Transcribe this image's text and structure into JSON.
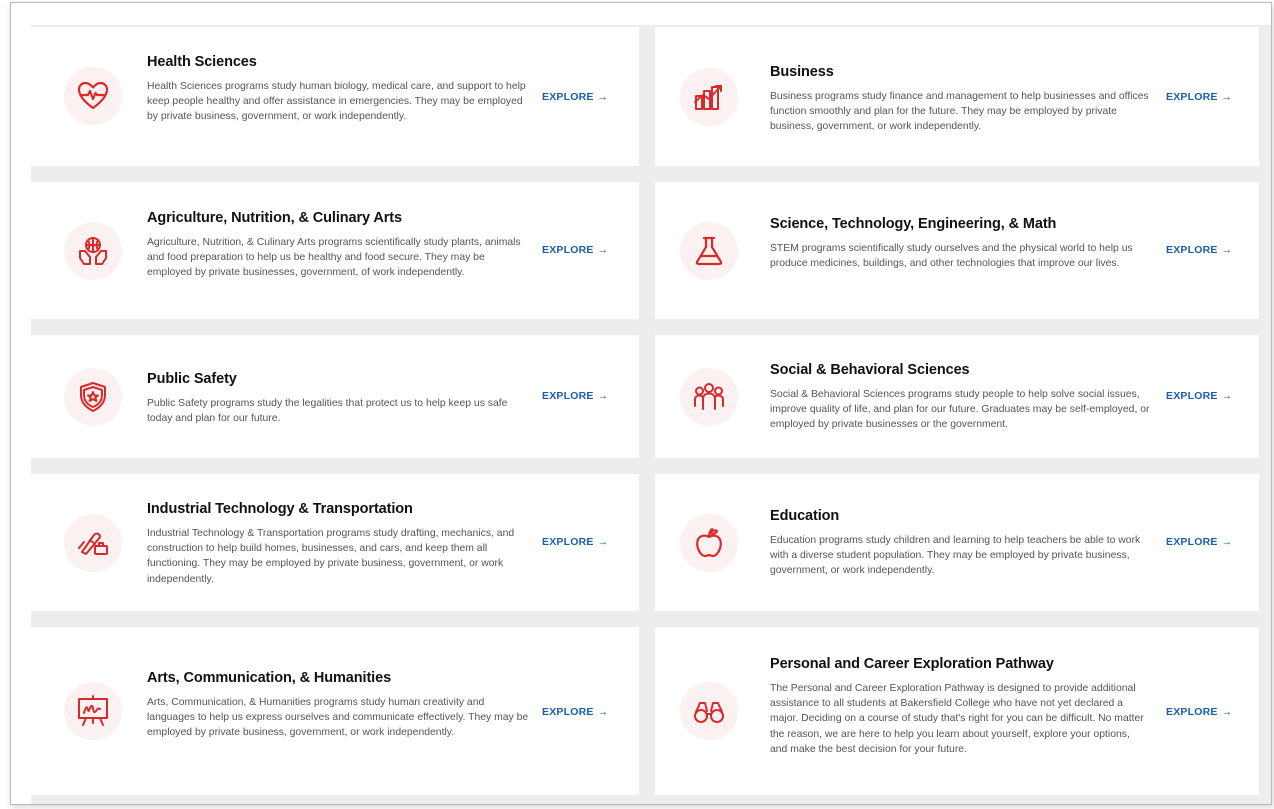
{
  "explore_label": "EXPLORE",
  "arrow": "→",
  "accent_color": "#d82a2a",
  "link_color": "#1c5fa8",
  "cards": [
    {
      "icon": "heart-pulse-icon",
      "title": "Health Sciences",
      "description": "Health Sciences programs study human biology, medical care, and support to help keep people healthy and offer assistance in emergencies. They may be employed by private business, government, or work independently."
    },
    {
      "icon": "business-chart-icon",
      "title": "Business",
      "description": "Business programs study finance and management to help businesses and offices function smoothly and plan for the future. They may be employed by private business, government, or work independently."
    },
    {
      "icon": "globe-hands-icon",
      "title": "Agriculture, Nutrition, & Culinary Arts",
      "description": "Agriculture, Nutrition, & Culinary Arts programs scientifically study plants, animals and food preparation to help us be healthy and food secure. They may be employed by private businesses, government, of work independently."
    },
    {
      "icon": "flask-icon",
      "title": "Science, Technology, Engineering, & Math",
      "description": "STEM programs scientifically study ourselves and the physical world to help us produce medicines, buildings, and other technologies that improve our lives."
    },
    {
      "icon": "shield-star-icon",
      "title": "Public Safety",
      "description": "Public Safety programs study the legalities that protect us to help keep us safe today and plan for our future."
    },
    {
      "icon": "people-group-icon",
      "title": "Social & Behavioral Sciences",
      "description": "Social & Behavioral Sciences programs study people to help solve social issues, improve quality of life, and plan for our future. Graduates may be self-employed, or employed by private businesses or the government."
    },
    {
      "icon": "tools-icon",
      "title": "Industrial Technology & Transportation",
      "description": "Industrial Technology & Transportation programs study drafting, mechanics, and construction to help build homes, businesses, and cars, and keep them all functioning. They may be employed by private business, government, or work independently."
    },
    {
      "icon": "apple-icon",
      "title": "Education",
      "description": "Education programs study children and learning to help teachers be able to work with a diverse student population. They may be employed by private business, government, or work independently."
    },
    {
      "icon": "easel-icon",
      "title": "Arts, Communication, & Humanities",
      "description": "Arts, Communication, & Humanities programs study human creativity and languages to help us express ourselves and communicate effectively. They may be employed by private business, government, or work independently."
    },
    {
      "icon": "binoculars-icon",
      "title": "Personal and Career Exploration Pathway",
      "description": "The Personal and Career Exploration Pathway is designed to provide additional assistance to all students at Bakersfield College who have not yet declared a major. Deciding on a course of study that's right for you can be difficult. No matter the reason, we are here to help you learn about yourself, explore your options, and make the best decision for your future."
    }
  ]
}
